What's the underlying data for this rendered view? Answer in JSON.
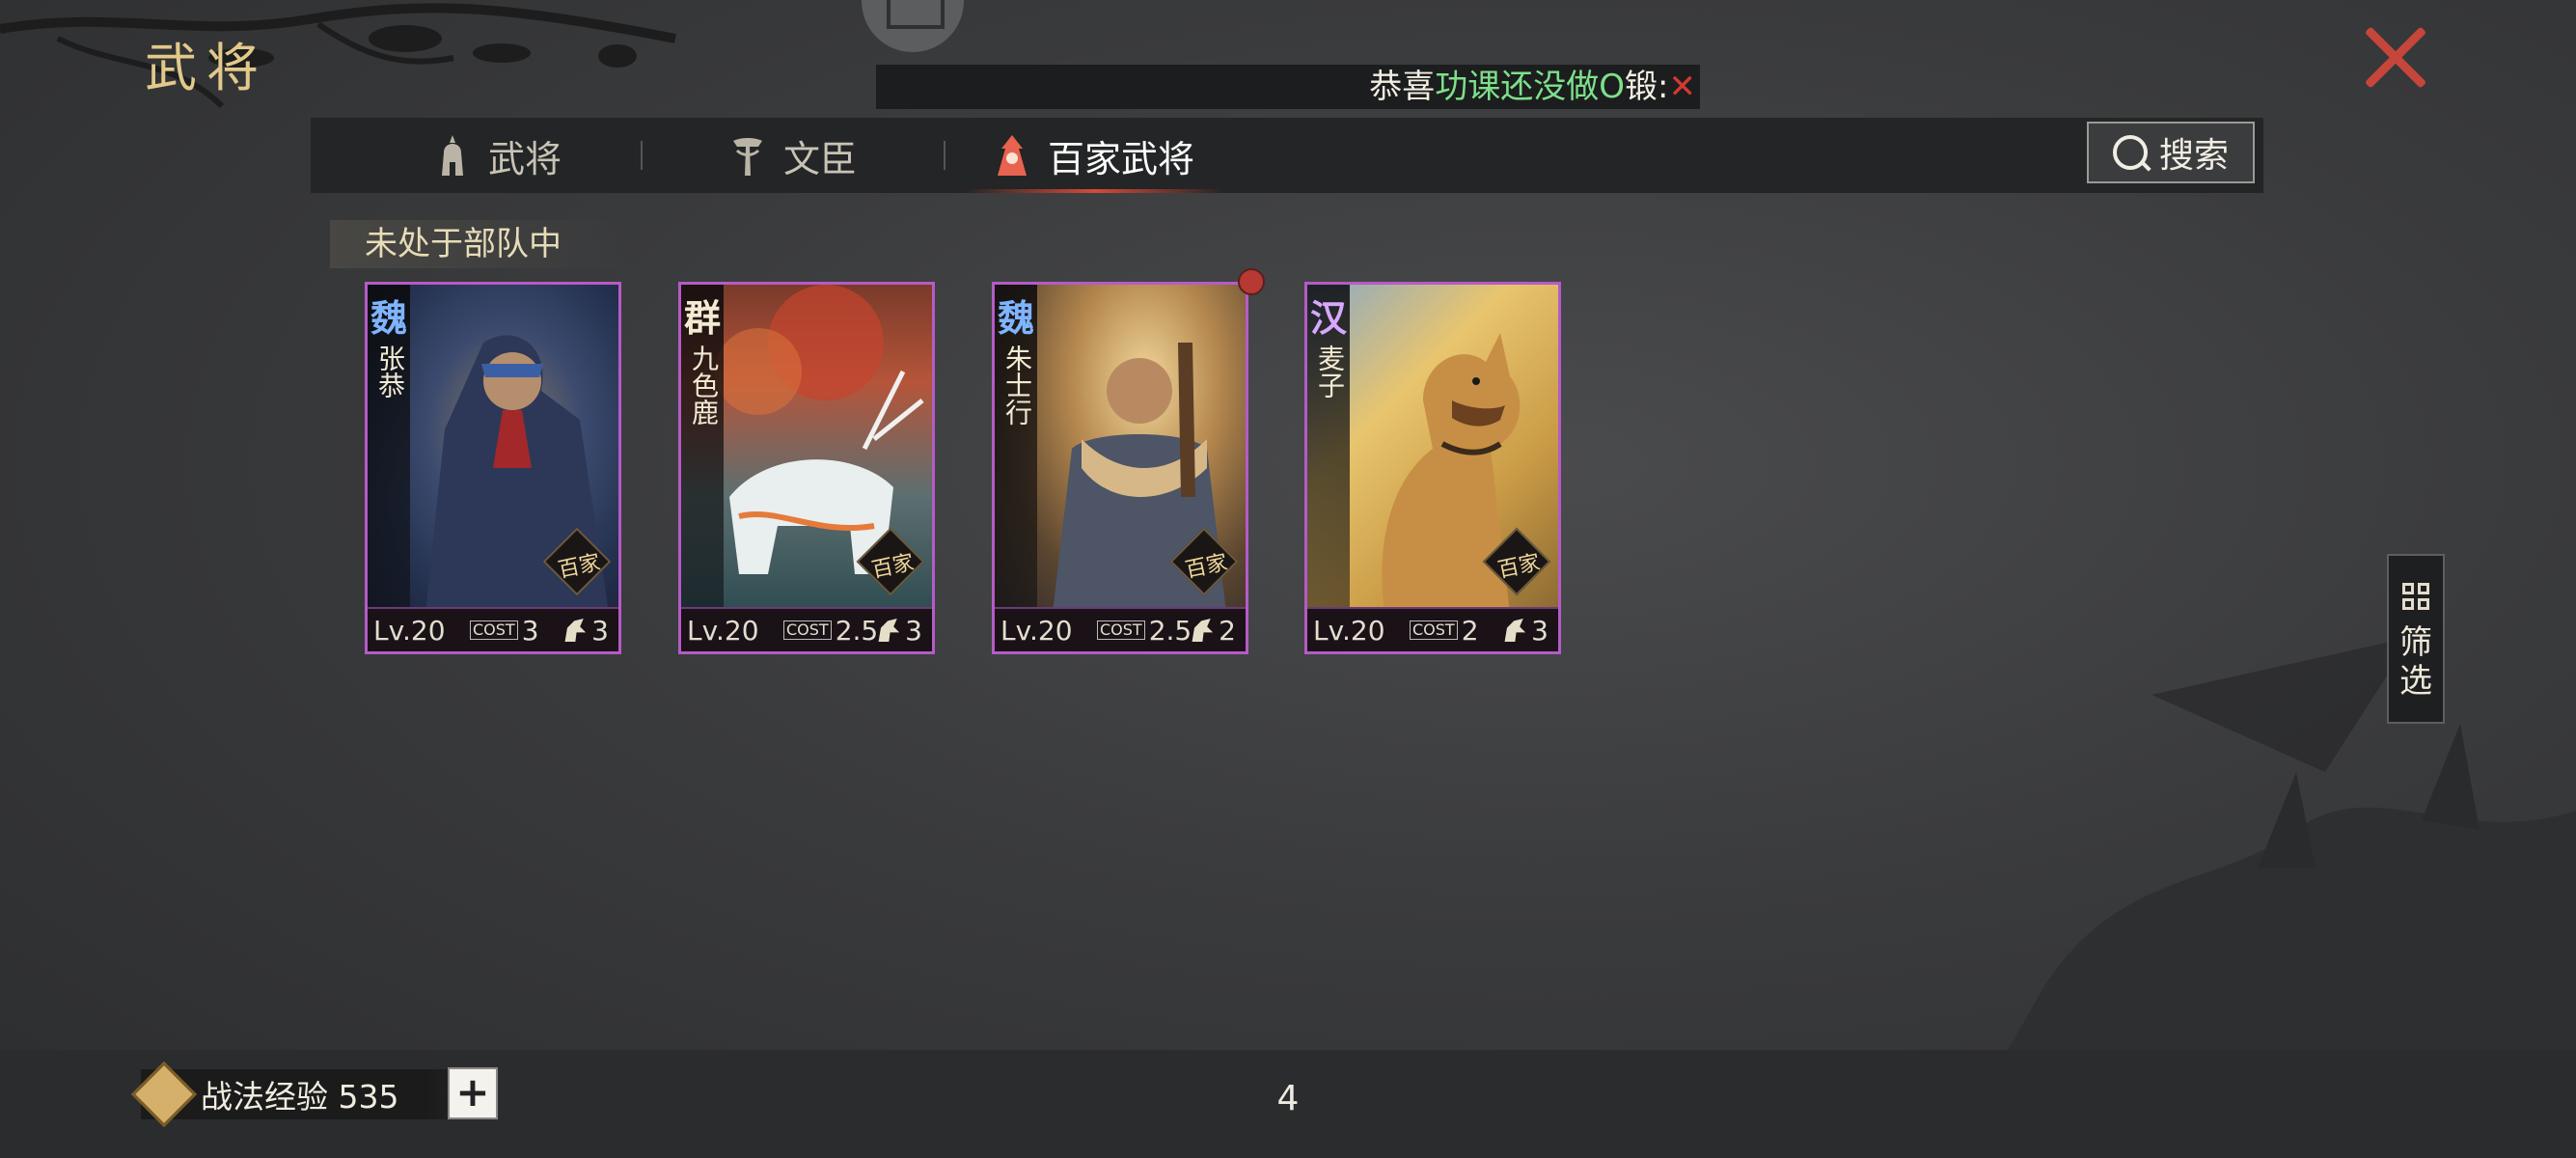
{
  "header": {
    "title": "武将"
  },
  "notice": {
    "prefix": "恭喜",
    "highlight": "功课还没做O",
    "suffix": "锻:",
    "close_glyph": "✕"
  },
  "tabs": [
    {
      "label": "武将",
      "icon": "helmet-icon",
      "active": false
    },
    {
      "label": "文臣",
      "icon": "scholar-icon",
      "active": false
    },
    {
      "label": "百家武将",
      "icon": "hundred-schools-icon",
      "active": true
    }
  ],
  "search": {
    "label": "搜索",
    "icon": "search-icon"
  },
  "section": {
    "title": "未处于部队中"
  },
  "cards": [
    {
      "faction": "魏",
      "faction_color": "#7fb4ff",
      "name": "张恭",
      "badge": "百家",
      "level": "Lv.20",
      "cost": "3",
      "troop": "3",
      "cost_icon": "cost-icon",
      "troop_icon": "cavalry-icon"
    },
    {
      "faction": "群",
      "faction_color": "#f2ead2",
      "name": "九色鹿",
      "badge": "百家",
      "level": "Lv.20",
      "cost": "2.5",
      "troop": "3",
      "cost_icon": "cost-icon",
      "troop_icon": "cavalry-icon"
    },
    {
      "faction": "魏",
      "faction_color": "#7fb4ff",
      "name": "朱士行",
      "badge": "百家",
      "level": "Lv.20",
      "cost": "2.5",
      "troop": "2",
      "cost_icon": "cost-icon",
      "troop_icon": "archer-icon"
    },
    {
      "faction": "汉",
      "faction_color": "#d6a8ff",
      "name": "麦子",
      "badge": "百家",
      "level": "Lv.20",
      "cost": "2",
      "troop": "3",
      "cost_icon": "cost-icon",
      "troop_icon": "cavalry-icon"
    }
  ],
  "filter": {
    "label": "筛选"
  },
  "footer": {
    "exp_label": "战法经验 535",
    "plus_label": "+",
    "count": "4"
  }
}
